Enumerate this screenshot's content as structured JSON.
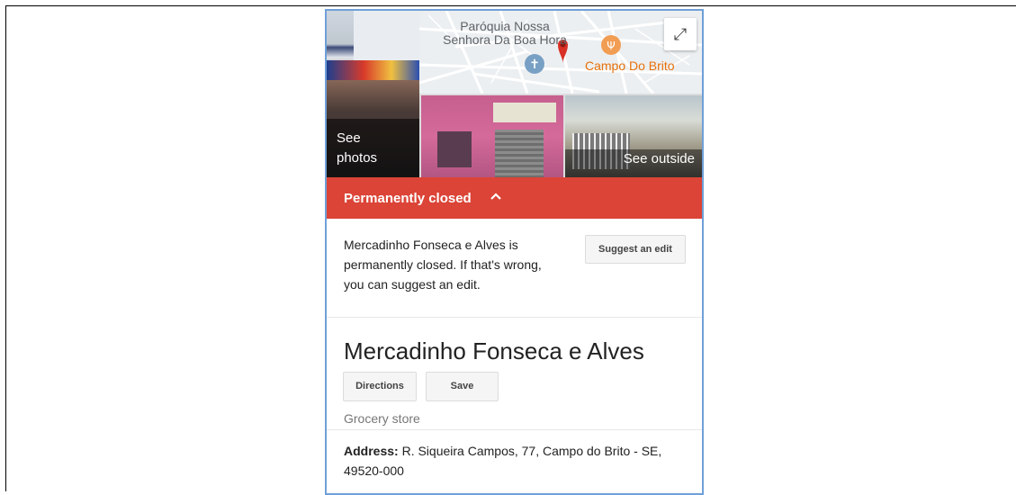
{
  "photos": {
    "see_photos": "See\nphotos",
    "see_outside": "See outside"
  },
  "map": {
    "label_church": "Paróquia Nossa Senhora Da Boa Hora",
    "label_place": "Campo Do Brito",
    "expand_icon": "expand-icon"
  },
  "banner": {
    "text": "Permanently closed",
    "color": "#db4437"
  },
  "closed_notice": {
    "message": "Mercadinho Fonseca e Alves is permanently closed. If that's wrong, you can suggest an edit.",
    "suggest_label": "Suggest an edit"
  },
  "place": {
    "name": "Mercadinho Fonseca e Alves",
    "directions_label": "Directions",
    "save_label": "Save",
    "category": "Grocery store",
    "address_label": "Address:",
    "address_value": "R. Siqueira Campos, 77, Campo do Brito - SE, 49520-000"
  }
}
